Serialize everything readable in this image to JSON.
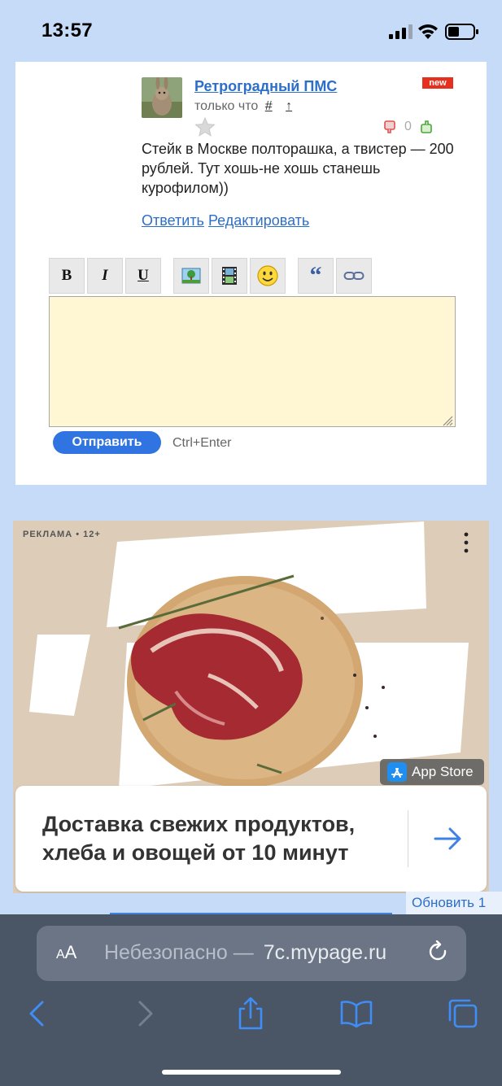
{
  "status_bar": {
    "time": "13:57"
  },
  "comment": {
    "author": "Ретроградный ПМС",
    "badge": "new",
    "time_label": "только что",
    "hash": "#",
    "up_arrow": "↑",
    "rating_value": "0",
    "text": "Стейк в Москве полторашка, а твистер — 200 рублей. Тут хошь-не хошь станешь курофилом))",
    "reply_label": "Ответить",
    "edit_label": "Редактировать"
  },
  "editor": {
    "toolbar": [
      {
        "name": "bold",
        "label": "B"
      },
      {
        "name": "italic",
        "label": "I"
      },
      {
        "name": "underline",
        "label": "U"
      },
      {
        "name": "image",
        "label": ""
      },
      {
        "name": "video",
        "label": ""
      },
      {
        "name": "smiley",
        "label": ""
      },
      {
        "name": "quote",
        "label": "“"
      },
      {
        "name": "link",
        "label": ""
      }
    ],
    "value": "",
    "send_label": "Отправить",
    "hint": "Ctrl+Enter"
  },
  "ad": {
    "label": "РЕКЛАМА • 12+",
    "store_label": "App Store",
    "headline": "Доставка свежих продуктов, хлеба и овощей от 10 минут"
  },
  "refresh_label": "Обновить 1",
  "browser": {
    "aa_small": "A",
    "aa_large": "A",
    "url_prefix": "Небезопасно — ",
    "url_cut": " ",
    "url_domain": "7c.mypage.ru"
  }
}
